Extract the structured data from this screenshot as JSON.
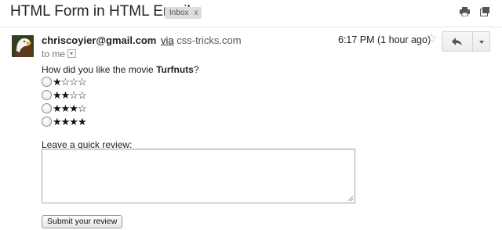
{
  "subject": "HTML Form in HTML Email",
  "label": {
    "text": "Inbox",
    "remove": "x"
  },
  "icons": {
    "print": "printer-icon",
    "new_window": "new-window-icon",
    "star": "star-outline-icon",
    "reply": "reply-arrow-icon",
    "more": "chevron-down-icon",
    "recipients_toggle": "chevron-down-icon"
  },
  "sender": {
    "email": "chriscoyier@gmail.com",
    "via": "via",
    "via_domain": "css-tricks.com",
    "to": "to me",
    "avatar_alt": "bald eagle avatar"
  },
  "time": "6:17 PM (1 hour ago)",
  "star_glyph": "☆",
  "body": {
    "question_prefix": "How did you like the movie ",
    "movie": "Turfnuts",
    "question_suffix": "?",
    "rating_options": [
      {
        "stars": "★☆☆☆",
        "value": 1,
        "selected": false
      },
      {
        "stars": "★★☆☆",
        "value": 2,
        "selected": false
      },
      {
        "stars": "★★★☆",
        "value": 3,
        "selected": false
      },
      {
        "stars": "★★★★",
        "value": 4,
        "selected": false
      }
    ],
    "review_label": "Leave a quick review:",
    "review_value": "",
    "submit_label": "Submit your review"
  },
  "colors": {
    "label_bg": "#dddddd",
    "divider": "#e5e5e5",
    "star_outline": "#bbbbbb"
  }
}
